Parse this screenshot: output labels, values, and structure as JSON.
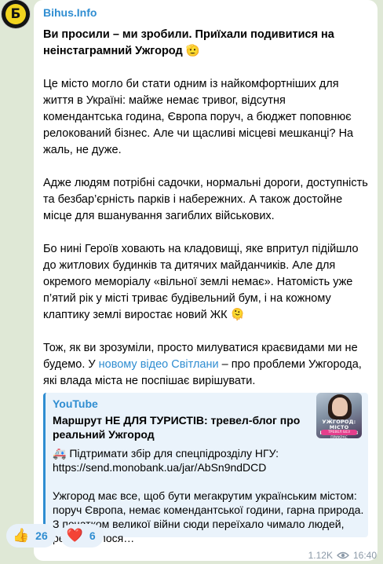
{
  "channel": {
    "name": "Bihus.Info",
    "avatar_glyph": "Б"
  },
  "post": {
    "title": "Ви просили – ми зробили. Приїхали подивитися на неінстаграмний Ужгород 🫡",
    "para1": "Це місто могло би стати одним із найкомфортніших для життя в Україні: майже немає тривог, відсутня комендантська година, Європа поруч, а бюджет поповнює релокований бізнес. Але чи щасливі місцеві мешканці? На жаль, не дуже.",
    "para2": "Адже людям потрібні садочки, нормальні дороги, доступність та безбар’єрність парків і набережних. А також достойне місце для вшанування загиблих військових.",
    "para3": "Бо нині Героїв ховають на кладовищі, яке впритул підійшло до житлових будинків та дитячих майданчиків. Але для окремого меморіалу «вільної землі немає». Натомість уже п’ятий рік у місті триває будівельний бум, і на кожному клаптику землі виростає новий ЖК 🫠",
    "para4_before": "Тож, як ви зрозуміли, просто милуватися краєвидами ми не будемо. У ",
    "para4_link": "новому відео Світлани",
    "para4_after": " – про проблеми Ужгорода, які влада міста не поспішає вирішувати."
  },
  "preview": {
    "site": "YouTube",
    "title": "Маршрут НЕ ДЛЯ ТУРИСТІВ: тревел-блог про реальний Ужгород",
    "donate": "🚑 Підтримати збір для спецпідрозділу НГУ: https://send.monobank.ua/jar/AbSn9ndDCD",
    "description": "Ужгород має все, щоб бути мегакрутим українським містом: поруч Європа, немає комендантської години, гарна природа. З початком великої війни сюди переїхало чимало людей, релокувалося…",
    "thumb_caption": "УЖГОРОД: МІСТО КОНТРАСТІВ",
    "thumb_tag": "ТРЕВЕЛ БЕЗ ПРИКРАС"
  },
  "reactions": [
    {
      "emoji": "👍",
      "count": "26"
    },
    {
      "emoji": "❤️",
      "count": "6"
    }
  ],
  "meta": {
    "views": "1.12K",
    "time": "16:40"
  }
}
